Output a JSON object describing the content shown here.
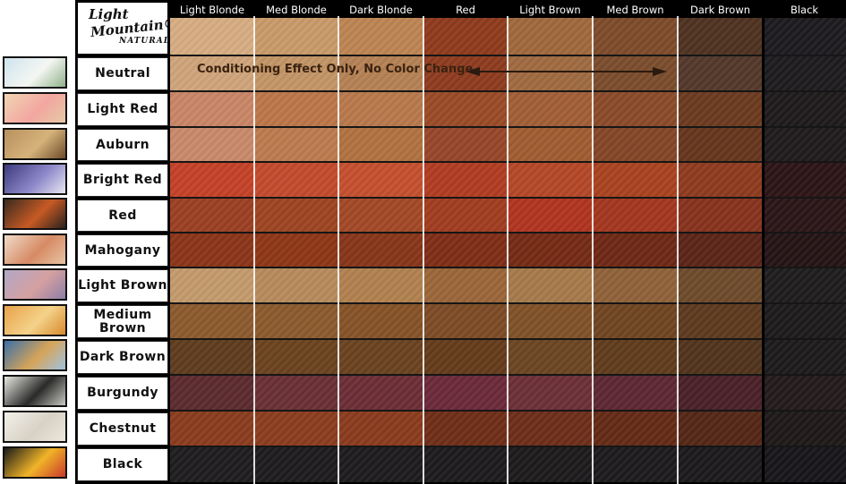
{
  "brand": {
    "line1": "Light",
    "line2": "Mountain®",
    "line3": "NATURAL"
  },
  "columns": [
    "Light Blonde",
    "Med Blonde",
    "Dark Blonde",
    "Red",
    "Light Brown",
    "Med Brown",
    "Dark Brown",
    "Black"
  ],
  "base_colors": [
    "#d7ad82",
    "#c99a69",
    "#bd8452",
    "#8f3a1c",
    "#a0683c",
    "#7d4b2a",
    "#4f3220",
    "#1c1a1e"
  ],
  "note": {
    "text": "Conditioning Effect Only, No Color Change",
    "row": "Neutral"
  },
  "rows": [
    {
      "label": "Neutral",
      "colors": [
        "#cfa47a",
        "#c39566",
        "#b58154",
        "#8e3b1e",
        "#9f6a40",
        "#7a4c2c",
        "#53382a",
        "#1d1b1e"
      ]
    },
    {
      "label": "Light Red",
      "colors": [
        "#c98566",
        "#bc7649",
        "#b8784b",
        "#9a4a26",
        "#a15e35",
        "#8a4a28",
        "#6b3a1f",
        "#1e1a1b"
      ]
    },
    {
      "label": "Auburn",
      "colors": [
        "#c9896a",
        "#bd7a4e",
        "#b1713f",
        "#97462a",
        "#a05c30",
        "#844526",
        "#66351c",
        "#1f1a1b"
      ]
    },
    {
      "label": "Bright Red",
      "colors": [
        "#c44127",
        "#c34a2c",
        "#c44f2d",
        "#b03c21",
        "#b44727",
        "#a9421f",
        "#8d3a1e",
        "#2c1416"
      ]
    },
    {
      "label": "Red",
      "colors": [
        "#9b3f22",
        "#9d4421",
        "#a24826",
        "#a03c1f",
        "#b0341f",
        "#a3361e",
        "#86321c",
        "#2a1517"
      ]
    },
    {
      "label": "Mahogany",
      "colors": [
        "#8a3418",
        "#8d3616",
        "#873519",
        "#7f2d16",
        "#742a14",
        "#6e2714",
        "#5b2417",
        "#241314"
      ]
    },
    {
      "label": "Light Brown",
      "colors": [
        "#c39a6c",
        "#b78b5c",
        "#b1814f",
        "#9a6638",
        "#a67a4b",
        "#8f6239",
        "#6e4a2b",
        "#1f1c1d"
      ]
    },
    {
      "label": "Medium Brown",
      "colors": [
        "#8c5a2d",
        "#8b5a2d",
        "#865226",
        "#7c4b24",
        "#805128",
        "#6f4521",
        "#5d391d",
        "#1c1a1b"
      ]
    },
    {
      "label": "Dark Brown",
      "colors": [
        "#5e3b1d",
        "#6b421f",
        "#6a421f",
        "#643b1a",
        "#6c4522",
        "#5f3b1b",
        "#50331b",
        "#1c1a1a"
      ]
    },
    {
      "label": "Burgundy",
      "colors": [
        "#5b2a2e",
        "#6a3034",
        "#6c2d36",
        "#6b293a",
        "#6c2f37",
        "#5d2732",
        "#4a2027",
        "#231a1c"
      ]
    },
    {
      "label": "Chestnut",
      "colors": [
        "#8a3b1d",
        "#8b3c1e",
        "#8a3a1d",
        "#6f2d17",
        "#6d2d19",
        "#632a16",
        "#532616",
        "#1e1818"
      ]
    },
    {
      "label": "Black",
      "colors": [
        "#1e1c1f",
        "#1d1b1e",
        "#1d1b1e",
        "#1c1a1d",
        "#1d1a1c",
        "#1c1a1d",
        "#1b191c",
        "#171519"
      ]
    }
  ],
  "thumbnails": [
    {
      "name": "egret-thumbnail",
      "colors": [
        "#cfe4ee",
        "#f4f6f2",
        "#8fb08a"
      ]
    },
    {
      "name": "cockatoo-thumbnail",
      "colors": [
        "#f0d6b3",
        "#f3a6a0",
        "#e6c9a6"
      ]
    },
    {
      "name": "cheetah-thumbnail",
      "colors": [
        "#b89060",
        "#d6b37a",
        "#6d4b2a"
      ]
    },
    {
      "name": "wolf-thumbnail",
      "colors": [
        "#3c3a7e",
        "#8d88c8",
        "#e8e6f2"
      ]
    },
    {
      "name": "fox-thumbnail",
      "colors": [
        "#3a2a20",
        "#c75a24",
        "#2a211d"
      ]
    },
    {
      "name": "nautilus-thumbnail",
      "colors": [
        "#f0dccb",
        "#d68a64",
        "#e9c4a4"
      ]
    },
    {
      "name": "elephant-thumbnail",
      "colors": [
        "#b0a8c8",
        "#d6a0a0",
        "#8d7ea8"
      ]
    },
    {
      "name": "antelope-thumbnail",
      "colors": [
        "#e8a24a",
        "#f4d28a",
        "#d7892d"
      ]
    },
    {
      "name": "lion-thumbnail",
      "colors": [
        "#3a6fa8",
        "#d6a45a",
        "#9fc2e0"
      ]
    },
    {
      "name": "zebra-thumbnail",
      "colors": [
        "#e8e8e2",
        "#2a2a2a",
        "#c9c9c2"
      ]
    },
    {
      "name": "polar-bear-thumbnail",
      "colors": [
        "#f3f0ea",
        "#d8d2c6",
        "#ece6dc"
      ]
    },
    {
      "name": "toucan-thumbnail",
      "colors": [
        "#1a1a1a",
        "#f0b428",
        "#c83a2a"
      ]
    }
  ]
}
